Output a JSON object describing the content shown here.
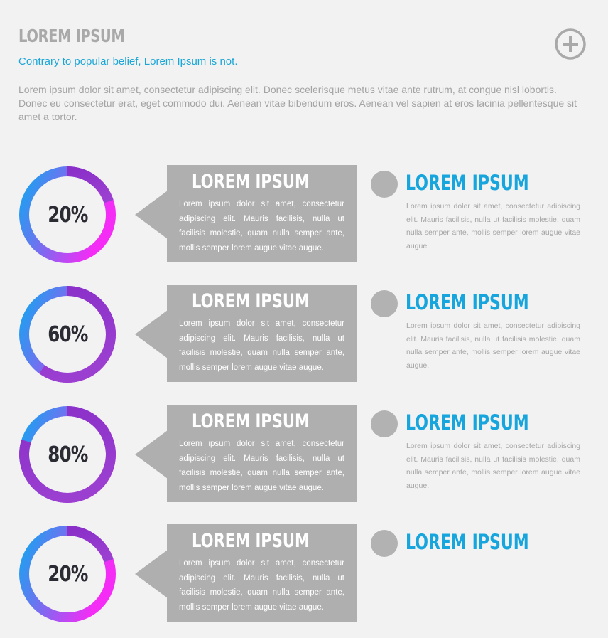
{
  "header": {
    "title": "LOREM IPSUM",
    "subtitle": "Contrary to popular belief, Lorem Ipsum is not.",
    "body": "Lorem ipsum dolor sit amet, consectetur adipiscing elit. Donec scelerisque metus vitae ante rutrum, at congue nisl lobortis. Donec eu consectetur erat, eget commodo dui. Aenean vitae bibendum eros. Aenean vel sapien at eros lacinia pellentesque sit amet a tortor.",
    "add_icon": "plus-circle-icon"
  },
  "colors": {
    "ring_blue": "#13a6f0",
    "ring_violet": "#9a3fd0",
    "ring_magenta": "#f52cf6",
    "box_gray": "#afafaf",
    "accent_blue": "#16a5dc"
  },
  "items": [
    {
      "percent_label": "20%",
      "percent": 20,
      "box_title": "LOREM IPSUM",
      "box_text": "Lorem ipsum dolor sit amet, consectetur adipiscing elit. Mauris facilisis, nulla ut facilisis molestie, quam nulla semper ante, mollis semper lorem augue vitae augue.",
      "side_title": "LOREM IPSUM",
      "side_text": "Lorem ipsum dolor sit amet, consectetur adipiscing elit. Mauris facilisis, nulla ut facilisis molestie, quam nulla semper ante, mollis semper lorem augue vitae augue."
    },
    {
      "percent_label": "60%",
      "percent": 60,
      "box_title": "LOREM IPSUM",
      "box_text": "Lorem ipsum dolor sit amet, consectetur adipiscing elit. Mauris facilisis, nulla ut facilisis molestie, quam nulla semper ante, mollis semper lorem augue vitae augue.",
      "side_title": "LOREM IPSUM",
      "side_text": "Lorem ipsum dolor sit amet, consectetur adipiscing elit. Mauris facilisis, nulla ut facilisis molestie, quam nulla semper ante, mollis semper lorem augue vitae augue."
    },
    {
      "percent_label": "80%",
      "percent": 80,
      "box_title": "LOREM IPSUM",
      "box_text": "Lorem ipsum dolor sit amet, consectetur adipiscing elit. Mauris facilisis, nulla ut facilisis molestie, quam nulla semper ante, mollis semper lorem augue vitae augue.",
      "side_title": "LOREM IPSUM",
      "side_text": "Lorem ipsum dolor sit amet, consectetur adipiscing elit. Mauris facilisis, nulla ut facilisis molestie, quam nulla semper ante, mollis semper lorem augue vitae augue."
    },
    {
      "percent_label": "20%",
      "percent": 20,
      "box_title": "LOREM IPSUM",
      "box_text": "Lorem ipsum dolor sit amet, consectetur adipiscing elit. Mauris facilisis, nulla ut facilisis molestie, quam nulla semper ante, mollis semper lorem augue vitae augue.",
      "side_title": "LOREM IPSUM",
      "side_text": ""
    }
  ]
}
